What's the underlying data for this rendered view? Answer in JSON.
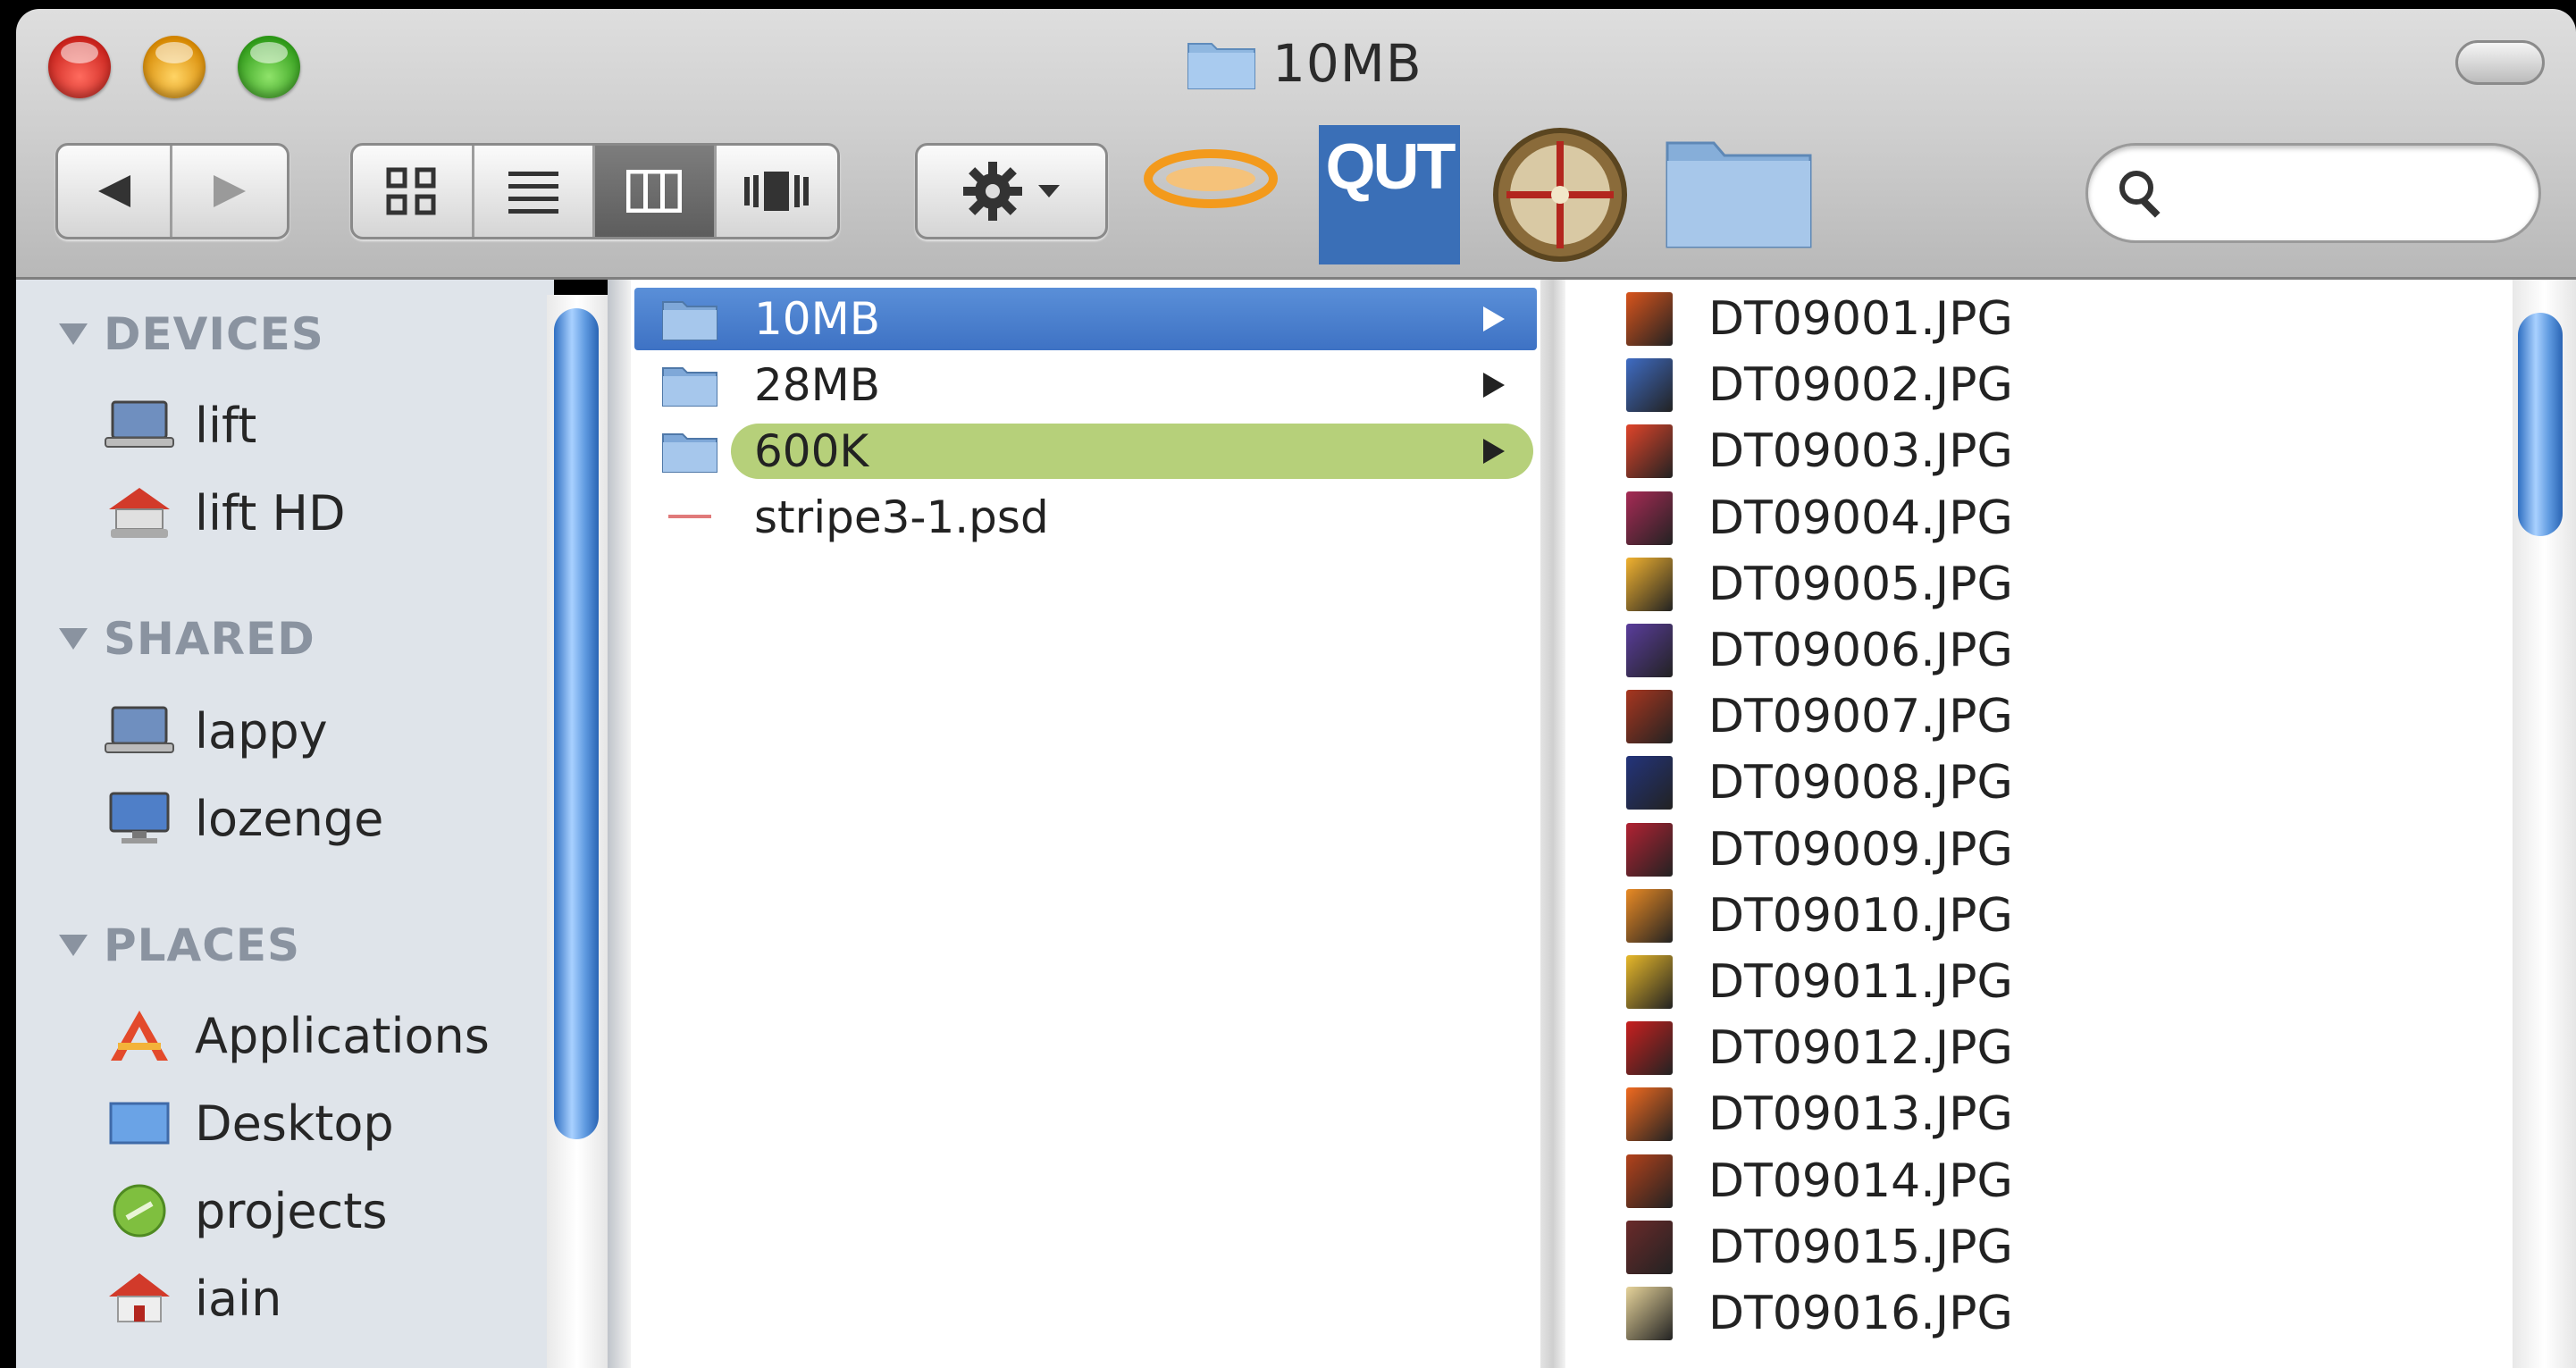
{
  "window": {
    "title": "10MB"
  },
  "toolbar": {
    "qut_label": "QUT",
    "search_placeholder": ""
  },
  "sidebar": {
    "sections": [
      {
        "label": "DEVICES",
        "items": [
          "lift",
          "lift HD"
        ]
      },
      {
        "label": "SHARED",
        "items": [
          "lappy",
          "lozenge"
        ]
      },
      {
        "label": "PLACES",
        "items": [
          "Applications",
          "Desktop",
          "projects",
          "iain"
        ]
      }
    ]
  },
  "column1": {
    "items": [
      {
        "name": "10MB",
        "type": "folder",
        "state": "selected"
      },
      {
        "name": "28MB",
        "type": "folder",
        "state": "normal"
      },
      {
        "name": "600K",
        "type": "folder",
        "state": "green-label"
      },
      {
        "name": "stripe3-1.psd",
        "type": "file",
        "state": "normal"
      }
    ]
  },
  "column2": {
    "files": [
      {
        "name": "DT09001.JPG",
        "color": "#d9541c"
      },
      {
        "name": "DT09002.JPG",
        "color": "#3f6cc4"
      },
      {
        "name": "DT09003.JPG",
        "color": "#e0442a"
      },
      {
        "name": "DT09004.JPG",
        "color": "#a72a55"
      },
      {
        "name": "DT09005.JPG",
        "color": "#f1b230"
      },
      {
        "name": "DT09006.JPG",
        "color": "#5a3d9c"
      },
      {
        "name": "DT09007.JPG",
        "color": "#a8361f"
      },
      {
        "name": "DT09008.JPG",
        "color": "#23347c"
      },
      {
        "name": "DT09009.JPG",
        "color": "#b22233"
      },
      {
        "name": "DT09010.JPG",
        "color": "#e98a24"
      },
      {
        "name": "DT09011.JPG",
        "color": "#e7b82a"
      },
      {
        "name": "DT09012.JPG",
        "color": "#c8201f"
      },
      {
        "name": "DT09013.JPG",
        "color": "#f06a20"
      },
      {
        "name": "DT09014.JPG",
        "color": "#b3421b"
      },
      {
        "name": "DT09015.JPG",
        "color": "#6a2a2a"
      },
      {
        "name": "DT09016.JPG",
        "color": "#e6d39a"
      }
    ]
  }
}
